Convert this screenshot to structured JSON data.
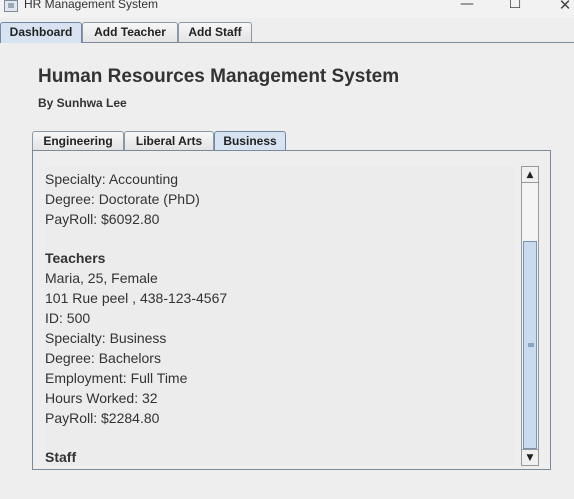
{
  "window": {
    "title": "HR Management System",
    "min": "—",
    "max": "☐",
    "close": "✕"
  },
  "top_tabs": [
    {
      "label": "Dashboard",
      "active": true
    },
    {
      "label": "Add Teacher",
      "active": false
    },
    {
      "label": "Add Staff",
      "active": false
    }
  ],
  "header": {
    "title": "Human Resources Management System",
    "byline": "By Sunhwa Lee"
  },
  "sub_tabs": [
    {
      "label": "Engineering",
      "active": false
    },
    {
      "label": "Liberal Arts",
      "active": false
    },
    {
      "label": "Business",
      "active": true
    }
  ],
  "content": {
    "lines": [
      {
        "text": "Specialty: Accounting",
        "bold": false
      },
      {
        "text": "Degree: Doctorate (PhD)",
        "bold": false
      },
      {
        "text": "PayRoll: $6092.80",
        "bold": false
      },
      {
        "text": "",
        "bold": false
      },
      {
        "text": "Teachers",
        "bold": true
      },
      {
        "text": "Maria, 25, Female",
        "bold": false
      },
      {
        "text": "101 Rue peel , 438-123-4567",
        "bold": false
      },
      {
        "text": "ID: 500",
        "bold": false
      },
      {
        "text": "Specialty: Business",
        "bold": false
      },
      {
        "text": "Degree: Bachelors",
        "bold": false
      },
      {
        "text": "Employment: Full Time",
        "bold": false
      },
      {
        "text": "Hours Worked: 32",
        "bold": false
      },
      {
        "text": "PayRoll: $2284.80",
        "bold": false
      },
      {
        "text": "",
        "bold": false
      },
      {
        "text": "Staff",
        "bold": true
      }
    ]
  },
  "scrollbar": {
    "up_icon": "▲",
    "down_icon": "▼"
  }
}
